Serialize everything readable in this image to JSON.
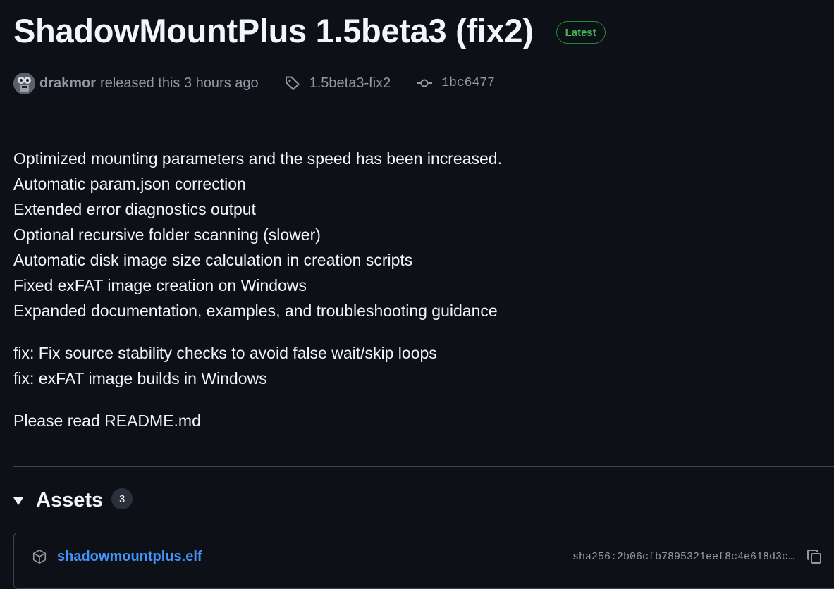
{
  "release": {
    "title": "ShadowMountPlus 1.5beta3 (fix2)",
    "badge": "Latest",
    "author": "drakmor",
    "released_text": "released this 3 hours ago",
    "tag": "1.5beta3-fix2",
    "commit": "1bc6477"
  },
  "notes": {
    "paragraph1": [
      "Optimized mounting parameters and the speed has been increased.",
      "Automatic param.json correction",
      "Extended error diagnostics output",
      "Optional recursive folder scanning (slower)",
      "Automatic disk image size calculation in creation scripts",
      "Fixed exFAT image creation on Windows",
      "Expanded documentation, examples, and troubleshooting guidance"
    ],
    "paragraph2": [
      "fix: Fix source stability checks to avoid false wait/skip loops",
      "fix: exFAT image builds in Windows"
    ],
    "paragraph3": [
      "Please read README.md"
    ]
  },
  "assets": {
    "title": "Assets",
    "count": "3",
    "items": [
      {
        "name": "shadowmountplus.elf",
        "sha": "sha256:2b06cfb7895321eef8c4e618d3c…",
        "icon": "package-icon"
      }
    ]
  },
  "colors": {
    "background": "#0d1117",
    "text": "#f0f6fc",
    "muted": "#9198a1",
    "link": "#4493f8",
    "latest_green": "#3fb950",
    "border": "#3d444d"
  }
}
